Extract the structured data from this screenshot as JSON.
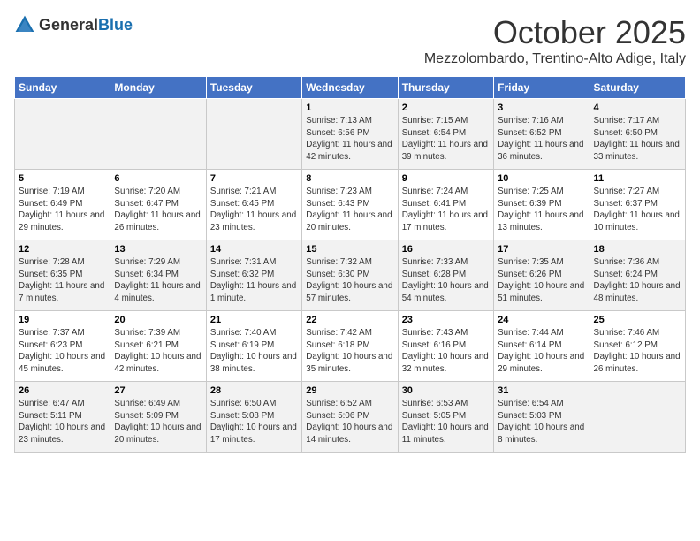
{
  "header": {
    "logo_general": "General",
    "logo_blue": "Blue",
    "month": "October 2025",
    "location": "Mezzolombardo, Trentino-Alto Adige, Italy"
  },
  "days_of_week": [
    "Sunday",
    "Monday",
    "Tuesday",
    "Wednesday",
    "Thursday",
    "Friday",
    "Saturday"
  ],
  "weeks": [
    [
      {
        "day": "",
        "info": ""
      },
      {
        "day": "",
        "info": ""
      },
      {
        "day": "",
        "info": ""
      },
      {
        "day": "1",
        "info": "Sunrise: 7:13 AM\nSunset: 6:56 PM\nDaylight: 11 hours and 42 minutes."
      },
      {
        "day": "2",
        "info": "Sunrise: 7:15 AM\nSunset: 6:54 PM\nDaylight: 11 hours and 39 minutes."
      },
      {
        "day": "3",
        "info": "Sunrise: 7:16 AM\nSunset: 6:52 PM\nDaylight: 11 hours and 36 minutes."
      },
      {
        "day": "4",
        "info": "Sunrise: 7:17 AM\nSunset: 6:50 PM\nDaylight: 11 hours and 33 minutes."
      }
    ],
    [
      {
        "day": "5",
        "info": "Sunrise: 7:19 AM\nSunset: 6:49 PM\nDaylight: 11 hours and 29 minutes."
      },
      {
        "day": "6",
        "info": "Sunrise: 7:20 AM\nSunset: 6:47 PM\nDaylight: 11 hours and 26 minutes."
      },
      {
        "day": "7",
        "info": "Sunrise: 7:21 AM\nSunset: 6:45 PM\nDaylight: 11 hours and 23 minutes."
      },
      {
        "day": "8",
        "info": "Sunrise: 7:23 AM\nSunset: 6:43 PM\nDaylight: 11 hours and 20 minutes."
      },
      {
        "day": "9",
        "info": "Sunrise: 7:24 AM\nSunset: 6:41 PM\nDaylight: 11 hours and 17 minutes."
      },
      {
        "day": "10",
        "info": "Sunrise: 7:25 AM\nSunset: 6:39 PM\nDaylight: 11 hours and 13 minutes."
      },
      {
        "day": "11",
        "info": "Sunrise: 7:27 AM\nSunset: 6:37 PM\nDaylight: 11 hours and 10 minutes."
      }
    ],
    [
      {
        "day": "12",
        "info": "Sunrise: 7:28 AM\nSunset: 6:35 PM\nDaylight: 11 hours and 7 minutes."
      },
      {
        "day": "13",
        "info": "Sunrise: 7:29 AM\nSunset: 6:34 PM\nDaylight: 11 hours and 4 minutes."
      },
      {
        "day": "14",
        "info": "Sunrise: 7:31 AM\nSunset: 6:32 PM\nDaylight: 11 hours and 1 minute."
      },
      {
        "day": "15",
        "info": "Sunrise: 7:32 AM\nSunset: 6:30 PM\nDaylight: 10 hours and 57 minutes."
      },
      {
        "day": "16",
        "info": "Sunrise: 7:33 AM\nSunset: 6:28 PM\nDaylight: 10 hours and 54 minutes."
      },
      {
        "day": "17",
        "info": "Sunrise: 7:35 AM\nSunset: 6:26 PM\nDaylight: 10 hours and 51 minutes."
      },
      {
        "day": "18",
        "info": "Sunrise: 7:36 AM\nSunset: 6:24 PM\nDaylight: 10 hours and 48 minutes."
      }
    ],
    [
      {
        "day": "19",
        "info": "Sunrise: 7:37 AM\nSunset: 6:23 PM\nDaylight: 10 hours and 45 minutes."
      },
      {
        "day": "20",
        "info": "Sunrise: 7:39 AM\nSunset: 6:21 PM\nDaylight: 10 hours and 42 minutes."
      },
      {
        "day": "21",
        "info": "Sunrise: 7:40 AM\nSunset: 6:19 PM\nDaylight: 10 hours and 38 minutes."
      },
      {
        "day": "22",
        "info": "Sunrise: 7:42 AM\nSunset: 6:18 PM\nDaylight: 10 hours and 35 minutes."
      },
      {
        "day": "23",
        "info": "Sunrise: 7:43 AM\nSunset: 6:16 PM\nDaylight: 10 hours and 32 minutes."
      },
      {
        "day": "24",
        "info": "Sunrise: 7:44 AM\nSunset: 6:14 PM\nDaylight: 10 hours and 29 minutes."
      },
      {
        "day": "25",
        "info": "Sunrise: 7:46 AM\nSunset: 6:12 PM\nDaylight: 10 hours and 26 minutes."
      }
    ],
    [
      {
        "day": "26",
        "info": "Sunrise: 6:47 AM\nSunset: 5:11 PM\nDaylight: 10 hours and 23 minutes."
      },
      {
        "day": "27",
        "info": "Sunrise: 6:49 AM\nSunset: 5:09 PM\nDaylight: 10 hours and 20 minutes."
      },
      {
        "day": "28",
        "info": "Sunrise: 6:50 AM\nSunset: 5:08 PM\nDaylight: 10 hours and 17 minutes."
      },
      {
        "day": "29",
        "info": "Sunrise: 6:52 AM\nSunset: 5:06 PM\nDaylight: 10 hours and 14 minutes."
      },
      {
        "day": "30",
        "info": "Sunrise: 6:53 AM\nSunset: 5:05 PM\nDaylight: 10 hours and 11 minutes."
      },
      {
        "day": "31",
        "info": "Sunrise: 6:54 AM\nSunset: 5:03 PM\nDaylight: 10 hours and 8 minutes."
      },
      {
        "day": "",
        "info": ""
      }
    ]
  ]
}
